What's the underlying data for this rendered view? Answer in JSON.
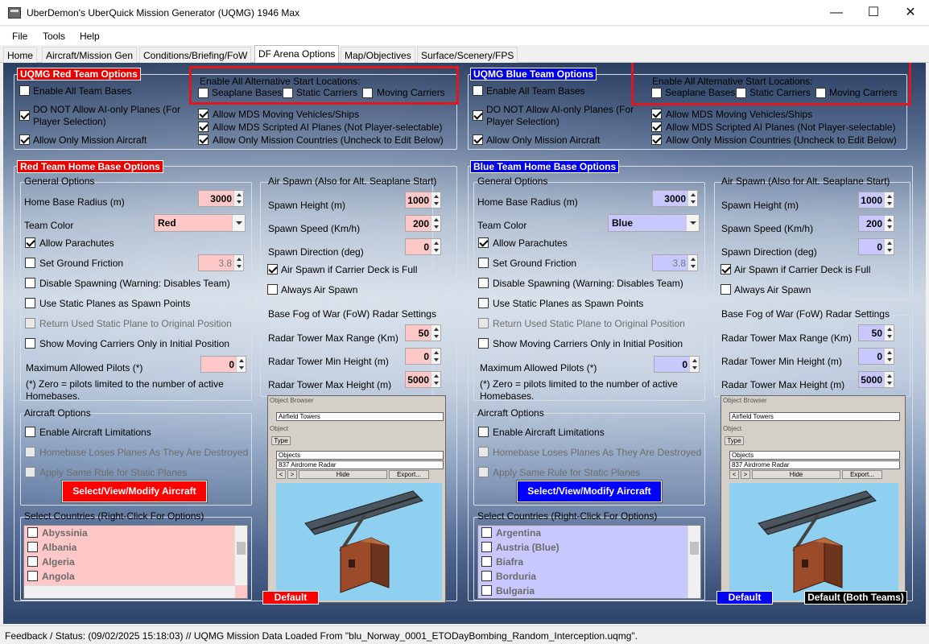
{
  "window": {
    "title": "UberDemon's UberQuick Mission Generator (UQMG) 1946 Max",
    "minimize_glyph": "—",
    "maximize_glyph": "☐",
    "close_glyph": "✕"
  },
  "menu": [
    "File",
    "Tools",
    "Help"
  ],
  "tabs": [
    "Home",
    "Aircraft/Mission Gen",
    "Conditions/Briefing/FoW",
    "DF Arena Options",
    "Map/Objectives",
    "Surface/Scenery/FPS"
  ],
  "active_tab": "DF Arena Options",
  "colors": {
    "red_team": "#e60000",
    "blue_team": "#0000e0",
    "highlight_box": "#e0181e"
  },
  "red": {
    "team_options": {
      "header": "UQMG Red Team Options",
      "enable_all_bases": "Enable All Team Bases",
      "no_ai_only_1": "DO NOT Allow AI-only  Planes (For",
      "no_ai_only_2": "Player Selection)",
      "allow_only_mission_aircraft": "Allow Only Mission Aircraft",
      "alt_start_title": "Enable All Alternative Start Locations:",
      "seaplane_bases": "Seaplane Bases",
      "static_carriers": "Static Carriers",
      "moving_carriers": "Moving Carriers",
      "mds_moving": "Allow MDS Moving Vehicles/Ships",
      "mds_scripted": "Allow MDS Scripted AI Planes (Not Player-selectable)",
      "only_mission_countries": "Allow Only Mission Countries (Uncheck to Edit Below)"
    },
    "home_base": {
      "header": "Red Team Home Base Options",
      "general_title": "General Options",
      "radius_label": "Home Base Radius (m)",
      "radius_value": "3000",
      "team_color_label": "Team Color",
      "team_color_value": "Red",
      "allow_parachutes": "Allow Parachutes",
      "set_ground_friction": "Set Ground Friction",
      "friction_value": "3.8",
      "disable_spawning": "Disable Spawning (Warning: Disables Team)",
      "static_planes_spawn": "Use Static Planes as Spawn Points",
      "return_static": "Return Used Static Plane to Original Position",
      "moving_carriers_initial": "Show Moving Carriers Only in Initial Position",
      "max_pilots_label": "Maximum Allowed Pilots (*)",
      "max_pilots_value": "0",
      "note_1": "(*) Zero = pilots limited to the number of active",
      "note_2": "Homebases.",
      "aircraft_title": "Aircraft Options",
      "enable_limitations": "Enable Aircraft Limitations",
      "loses_planes": "Homebase Loses Planes As They Are Destroyed",
      "same_rule_static": "Apply Same Rule for Static Planes",
      "select_aircraft_button": "Select/View/Modify Aircraft",
      "countries_title": "Select Countries (Right-Click For Options)",
      "countries": [
        "Abyssinia",
        "Albania",
        "Algeria",
        "Angola"
      ],
      "default_button": "Default"
    },
    "air_spawn": {
      "title": "Air Spawn (Also for Alt. Seaplane Start)",
      "height_label": "Spawn Height (m)",
      "height_value": "1000",
      "speed_label": "Spawn Speed (Km/h)",
      "speed_value": "200",
      "direction_label": "Spawn Direction (deg)",
      "direction_value": "0",
      "carrier_full": "Air Spawn if Carrier Deck is Full",
      "always": "Always Air Spawn"
    },
    "fow": {
      "title": "Base Fog of War (FoW) Radar Settings",
      "max_range_label": "Radar Tower Max Range (Km)",
      "max_range_value": "50",
      "min_height_label": "Radar Tower Min Height (m)",
      "min_height_value": "0",
      "max_height_label": "Radar Tower Max Height (m)",
      "max_height_value": "5000"
    },
    "preview": {
      "browser_title": "Object Browser",
      "category": "Airfield Towers",
      "object_label": "Object",
      "type_tab": "Type",
      "objects": "Objects",
      "item": "837 Airdrome Radar",
      "prev": "<",
      "next": ">",
      "hide": "Hide",
      "export": "Export..."
    }
  },
  "blue": {
    "team_options": {
      "header": "UQMG Blue Team Options",
      "enable_all_bases": "Enable All Team Bases",
      "no_ai_only_1": "DO NOT Allow AI-only  Planes (For",
      "no_ai_only_2": "Player Selection)",
      "allow_only_mission_aircraft": "Allow Only Mission Aircraft",
      "alt_start_title": "Enable All Alternative Start Locations:",
      "seaplane_bases": "Seaplane Bases",
      "static_carriers": "Static Carriers",
      "moving_carriers": "Moving Carriers",
      "mds_moving": "Allow MDS Moving Vehicles/Ships",
      "mds_scripted": "Allow MDS Scripted AI Planes (Not Player-selectable)",
      "only_mission_countries": "Allow Only Mission Countries (Uncheck to Edit Below)"
    },
    "home_base": {
      "header": "Blue Team Home Base Options",
      "general_title": "General Options",
      "radius_label": "Home Base Radius (m)",
      "radius_value": "3000",
      "team_color_label": "Team Color",
      "team_color_value": "Blue",
      "allow_parachutes": "Allow Parachutes",
      "set_ground_friction": "Set Ground Friction",
      "friction_value": "3.8",
      "disable_spawning": "Disable Spawning (Warning: Disables Team)",
      "static_planes_spawn": "Use Static Planes as Spawn Points",
      "return_static": "Return Used Static Plane to Original Position",
      "moving_carriers_initial": "Show Moving Carriers Only in Initial Position",
      "max_pilots_label": "Maximum Allowed Pilots (*)",
      "max_pilots_value": "0",
      "note_1": "(*) Zero = pilots limited to the number of active",
      "note_2": "Homebases.",
      "aircraft_title": "Aircraft Options",
      "enable_limitations": "Enable Aircraft Limitations",
      "loses_planes": "Homebase Loses Planes As They Are Destroyed",
      "same_rule_static": "Apply Same Rule for Static Planes",
      "select_aircraft_button": "Select/View/Modify Aircraft",
      "countries_title": "Select Countries (Right-Click For Options)",
      "countries": [
        "Argentina",
        "Austria (Blue)",
        "Biafra",
        "Borduria",
        "Bulgaria"
      ],
      "default_button": "Default"
    },
    "air_spawn": {
      "title": "Air Spawn (Also for Alt. Seaplane Start)",
      "height_label": "Spawn Height (m)",
      "height_value": "1000",
      "speed_label": "Spawn Speed (Km/h)",
      "speed_value": "200",
      "direction_label": "Spawn Direction (deg)",
      "direction_value": "0",
      "carrier_full": "Air Spawn if Carrier Deck is Full",
      "always": "Always Air Spawn"
    },
    "fow": {
      "title": "Base Fog of War (FoW) Radar Settings",
      "max_range_label": "Radar Tower Max Range (Km)",
      "max_range_value": "50",
      "min_height_label": "Radar Tower Min Height (m)",
      "min_height_value": "0",
      "max_height_label": "Radar Tower Max Height (m)",
      "max_height_value": "5000"
    },
    "preview": {
      "browser_title": "Object Browser",
      "category": "Airfield Towers",
      "object_label": "Object",
      "type_tab": "Type",
      "objects": "Objects",
      "item": "837 Airdrome Radar",
      "prev": "<",
      "next": ">",
      "hide": "Hide",
      "export": "Export..."
    },
    "default_both": "Default (Both Teams)"
  },
  "status": {
    "text": "Feedback / Status:   (09/02/2025 15:18:03) // UQMG Mission Data Loaded From \"blu_Norway_0001_ETODayBombing_Random_Interception.uqmg\"."
  }
}
